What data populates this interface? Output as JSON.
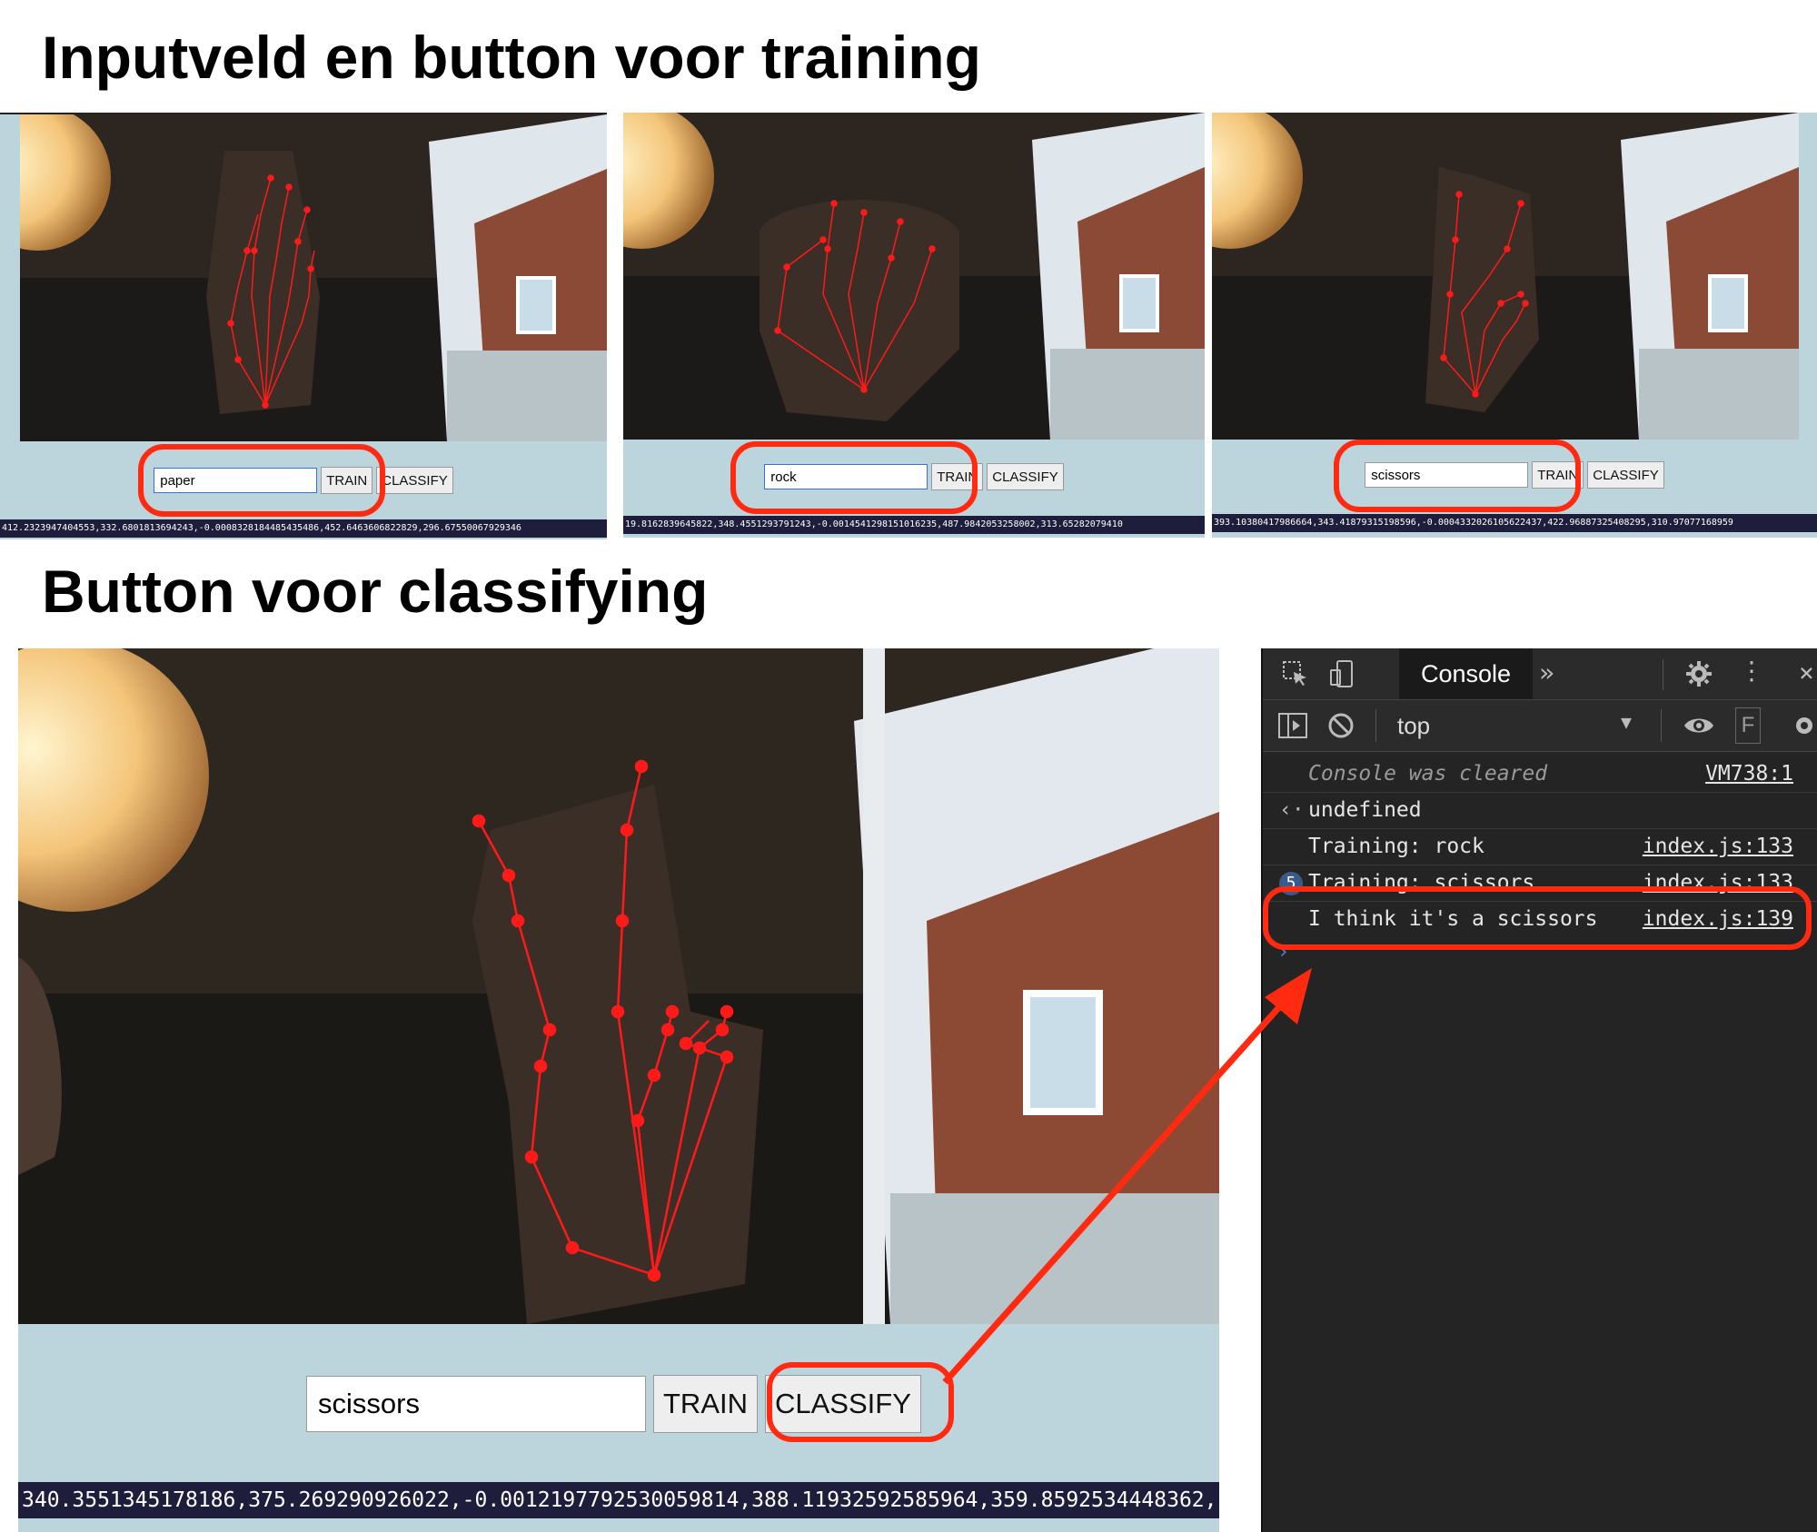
{
  "headings": {
    "training": "Inputveld en button voor training",
    "classifying": "Button voor classifying"
  },
  "training_panels": [
    {
      "input_value": "paper",
      "train_label": "TRAIN",
      "classify_label": "CLASSIFY",
      "data": "412.2323947404553,332.6801813694243,-0.0008328184485435486,452.6463606822829,296.67550067929346"
    },
    {
      "input_value": "rock",
      "train_label": "TRAIN",
      "classify_label": "CLASSIFY",
      "data": "19.8162839645822,348.4551293791243,-0.0014541298151016235,487.9842053258002,313.65282079410"
    },
    {
      "input_value": "scissors",
      "train_label": "TRAIN",
      "classify_label": "CLASSIFY",
      "data": "393.10380417986664,343.41879315198596,-0.0004332026105622437,422.96887325408295,310.97077168959"
    }
  ],
  "classify_panel": {
    "input_value": "scissors",
    "train_label": "TRAIN",
    "classify_label": "CLASSIFY",
    "data": "340.3551345178186,375.269290926022,-0.0012197792530059814,388.11932592585964,359.8592534448362,-"
  },
  "devtools": {
    "tab_label": "Console",
    "context": "top",
    "filter_label": "F",
    "lines": [
      {
        "text": "Console was cleared",
        "source": "VM738:1"
      },
      {
        "text": "undefined",
        "source": ""
      },
      {
        "text": "Training: rock",
        "source": "index.js:133"
      },
      {
        "text": "Training: scissors",
        "source": "index.js:133",
        "count": "5"
      },
      {
        "text": "I think it's a scissors",
        "source": "index.js:139"
      }
    ]
  },
  "colors": {
    "highlight": "#ff2a10",
    "panel_bg": "#bcd4db",
    "landmark": "#ff1a1a",
    "devtools_bg": "#242424"
  },
  "icons": [
    "inspect-icon",
    "device-toolbar-icon",
    "more-tabs-icon",
    "gear-icon",
    "kebab-menu-icon",
    "close-icon",
    "sidebar-toggle-icon",
    "clear-console-icon",
    "dropdown-caret-icon",
    "eye-icon",
    "expand-arrow-icon"
  ]
}
